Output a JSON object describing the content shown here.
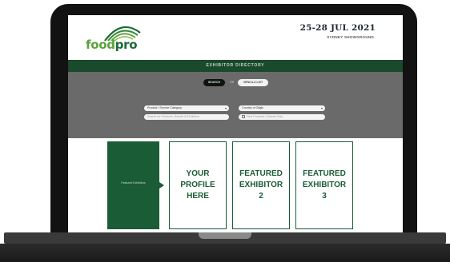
{
  "brand": {
    "logo_text": "foodpro",
    "logo_colors": [
      "#5aa33a",
      "#1a6b3a"
    ]
  },
  "event": {
    "dates": "25-28 JUL 2021",
    "venue": "SYDNEY SHOWGROUND"
  },
  "directory": {
    "title": "EXHIBITOR DIRECTORY"
  },
  "search": {
    "product_category": {
      "value": "Product / Service Category"
    },
    "country": {
      "value": "Country of Origin"
    },
    "keyword": {
      "placeholder": "Search for Products, Brands & Exhibitors"
    },
    "new_products": {
      "label": "New Products / Brands Only",
      "checked": false
    },
    "search_button": "SEARCH",
    "or_text": "OR",
    "view_all_button": "VIEW A-Z LIST"
  },
  "featured": {
    "green_tile_label": "Featured Exhibitors",
    "cards": [
      {
        "lines": [
          "YOUR",
          "PROFILE",
          "HERE"
        ]
      },
      {
        "lines": [
          "FEATURED",
          "EXHIBITOR",
          "2"
        ]
      },
      {
        "lines": [
          "FEATURED",
          "EXHIBITOR",
          "3"
        ]
      }
    ]
  },
  "colors": {
    "brand_green": "#1a5c35",
    "header_band": "#1a4a2c",
    "search_bg": "#6a6a6a",
    "laptop_bezel": "#121212"
  }
}
